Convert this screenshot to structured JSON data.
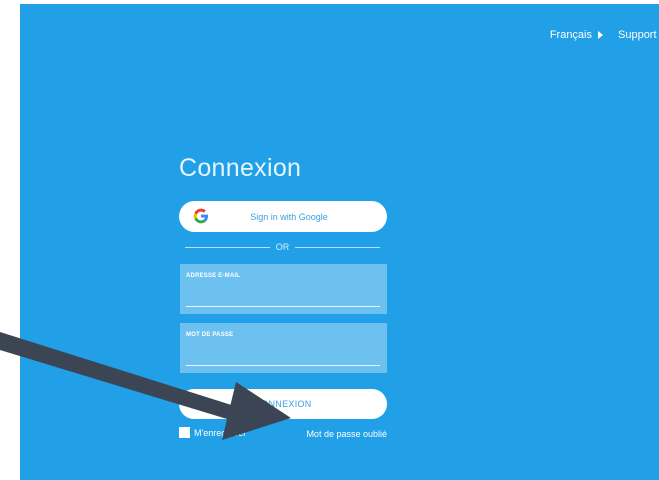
{
  "header": {
    "language_label": "Français",
    "support_label": "Support T"
  },
  "login": {
    "title": "Connexion",
    "google_button_label": "Sign in with Google",
    "divider_label": "OR",
    "email_label": "ADRESSE E-MAIL",
    "email_value": "",
    "password_label": "MOT DE PASSE",
    "password_value": "",
    "submit_label": "CONNEXION",
    "remember_label": "M'enregistrer",
    "forgot_label": "Mot de passe oublié"
  },
  "colors": {
    "background": "#21a0e8",
    "field_background": "#6cc1f1",
    "button_text": "#3d9ee0",
    "annotation_arrow": "#3b4553"
  },
  "icons": {
    "language_dropdown": "triangle-right-icon",
    "google": "google-g-icon",
    "annotation": "arrow-annotation-icon"
  }
}
